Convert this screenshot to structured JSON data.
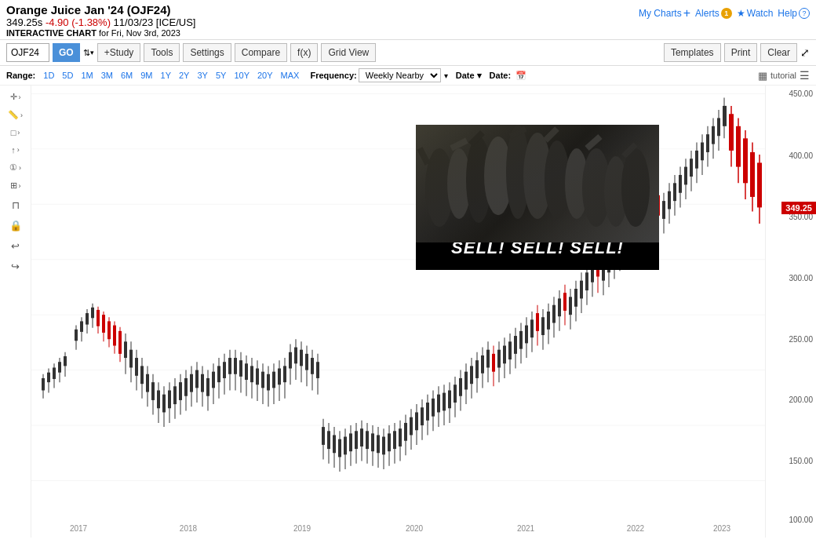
{
  "header": {
    "title": "Orange Juice Jan '24 (OJF24)",
    "price": "349.25s",
    "change": "-4.90 (-1.38%)",
    "date": "11/03/23",
    "exchange": "[ICE/US]",
    "interactive_label": "INTERACTIVE CHART",
    "for_date": "for Fri, Nov 3rd, 2023"
  },
  "top_nav": {
    "my_charts_label": "My Charts",
    "alerts_label": "Alerts",
    "alerts_badge": "1",
    "watch_label": "Watch",
    "help_label": "Help"
  },
  "toolbar": {
    "symbol_value": "OJF24",
    "go_label": "GO",
    "study_label": "+Study",
    "tools_label": "Tools",
    "settings_label": "Settings",
    "compare_label": "Compare",
    "fx_label": "f(x)",
    "grid_view_label": "Grid View",
    "templates_label": "Templates",
    "print_label": "Print",
    "clear_label": "Clear"
  },
  "range_bar": {
    "range_label": "Range:",
    "ranges": [
      "1D",
      "5D",
      "1M",
      "3M",
      "6M",
      "9M",
      "1Y",
      "2Y",
      "3Y",
      "5Y",
      "10Y",
      "20Y",
      "MAX"
    ],
    "frequency_label": "Frequency:",
    "frequency_value": "Weekly Nearby",
    "date_label": "Date",
    "date_colon": "Date:",
    "tutorial_label": "tutorial"
  },
  "price_axis": {
    "labels": [
      "450.00",
      "400.00",
      "350.00",
      "300.00",
      "250.00",
      "200.00",
      "150.00",
      "100.00"
    ],
    "current_price": "349.25"
  },
  "gif_overlay": {
    "text": "SELL! SELL! SELL!"
  },
  "year_labels": [
    "2017",
    "2018",
    "2019",
    "2020",
    "2021",
    "2022",
    "2023"
  ],
  "chart": {
    "accent_color": "#cc0000",
    "up_color": "#000000",
    "down_color": "#cc0000"
  }
}
